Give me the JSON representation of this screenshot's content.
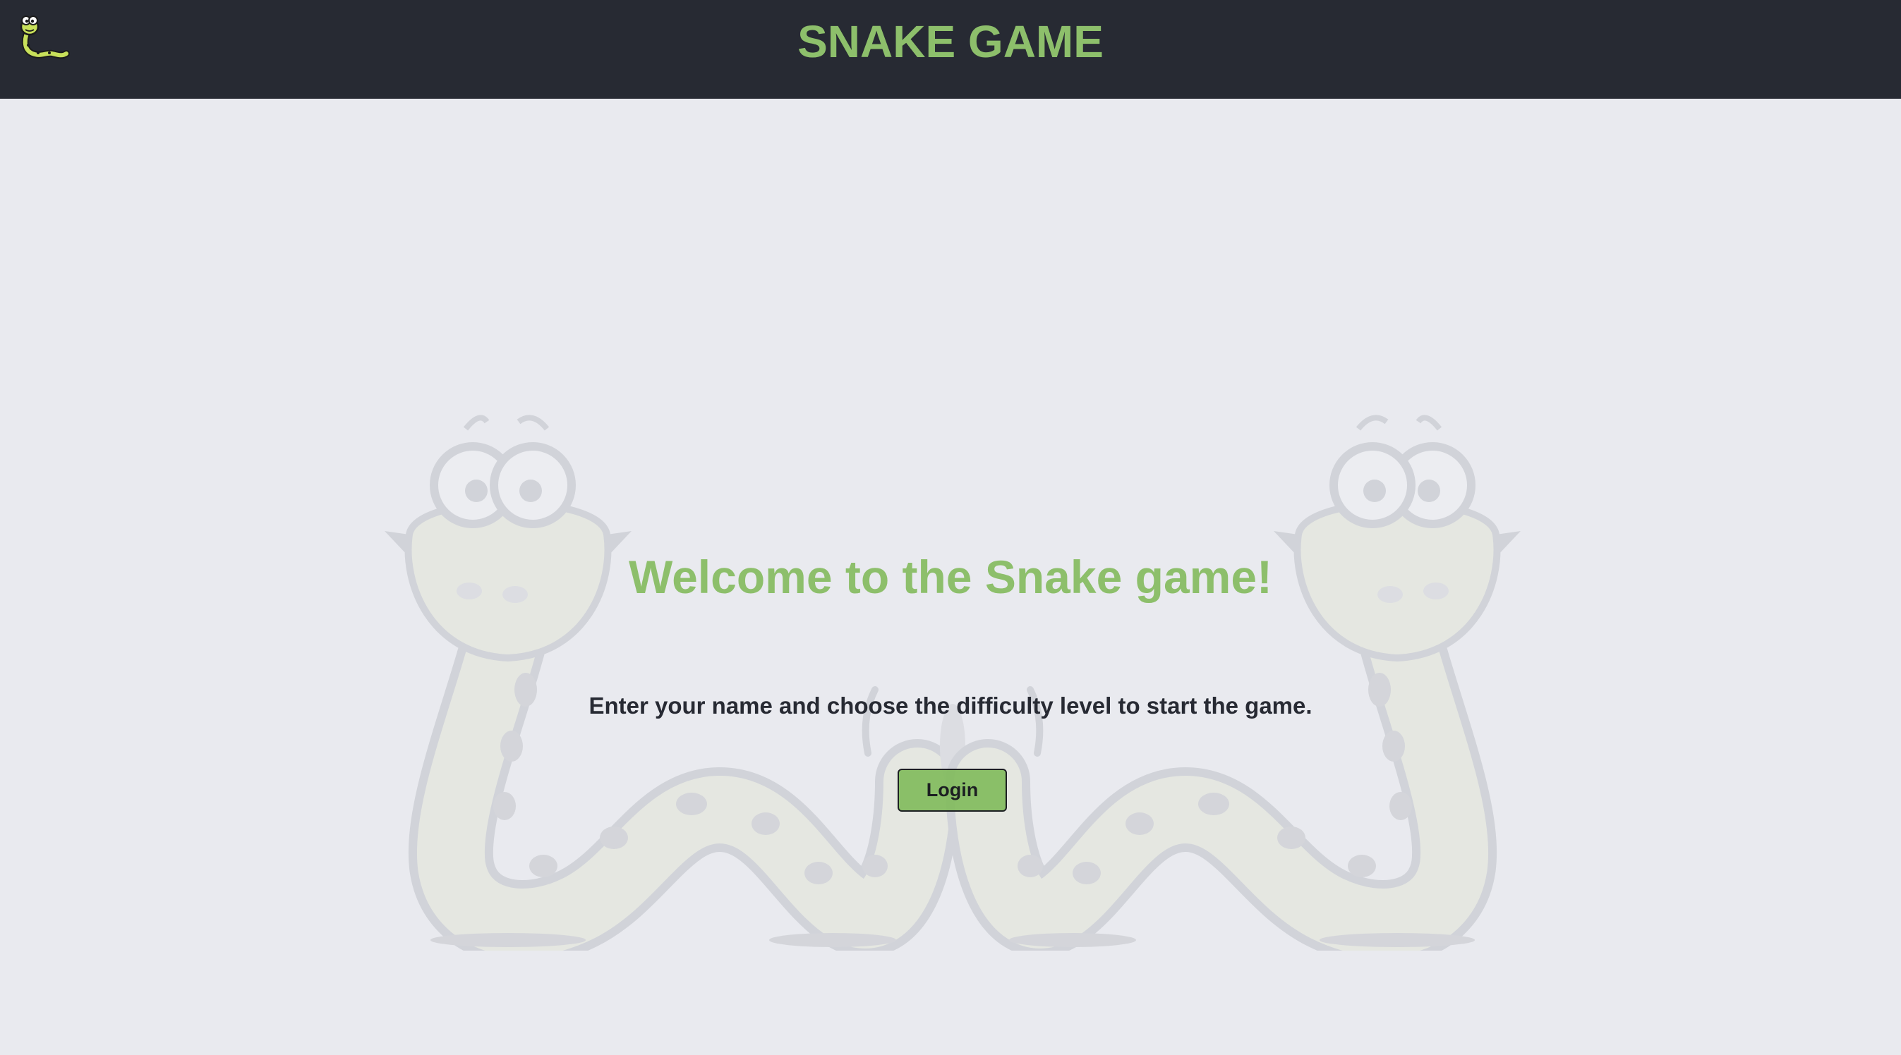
{
  "header": {
    "title": "SNAKE GAME",
    "logo_icon": "snake-logo-icon"
  },
  "main": {
    "welcome": "Welcome to the Snake game!",
    "instructions": "Enter your name and choose the difficulty level to start the game.",
    "login_label": "Login",
    "background_icon": "snakes-illustration"
  },
  "colors": {
    "header_bg": "#272a33",
    "page_bg": "#e9eaef",
    "accent_green": "#8dbf6b",
    "text_dark": "#272a33"
  }
}
